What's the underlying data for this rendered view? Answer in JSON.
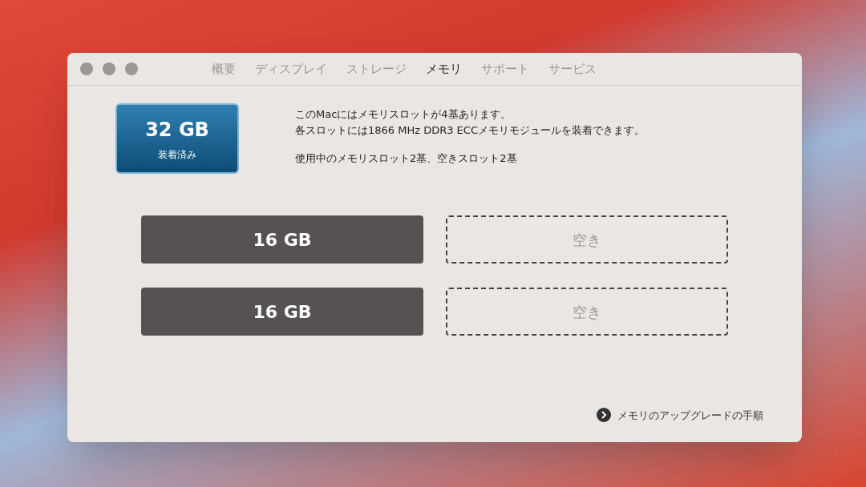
{
  "tabs": [
    {
      "label": "概要",
      "selected": false
    },
    {
      "label": "ディスプレイ",
      "selected": false
    },
    {
      "label": "ストレージ",
      "selected": false
    },
    {
      "label": "メモリ",
      "selected": true
    },
    {
      "label": "サポート",
      "selected": false
    },
    {
      "label": "サービス",
      "selected": false
    }
  ],
  "summary": {
    "amount": "32 GB",
    "caption": "装着済み"
  },
  "info": {
    "lines": [
      "このMacにはメモリスロットが4基あります。",
      "各スロットには1866 MHz DDR3 ECCメモリモジュールを装着できます。"
    ],
    "usage": "使用中のメモリスロット2基、空きスロット2基"
  },
  "slots": [
    {
      "kind": "filled",
      "label": "16 GB"
    },
    {
      "kind": "empty",
      "label": "空き"
    },
    {
      "kind": "filled",
      "label": "16 GB"
    },
    {
      "kind": "empty",
      "label": "空き"
    }
  ],
  "upgrade_link": "メモリのアップグレードの手順"
}
